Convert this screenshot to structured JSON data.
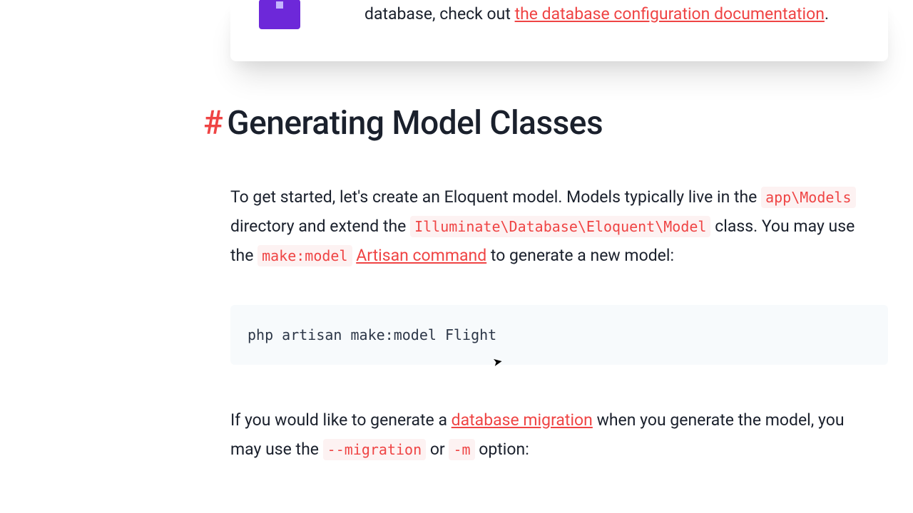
{
  "callout": {
    "text_prefix": "database, check out ",
    "link_text": "the database configuration documentation",
    "text_suffix": "."
  },
  "heading": {
    "hash": "#",
    "title": "Generating Model Classes"
  },
  "para1": {
    "t1": "To get started, let's create an Eloquent model. Models typically live in the ",
    "code1": "app\\Models",
    "t2": " directory and extend the ",
    "code2": "Illuminate\\Database\\Eloquent\\Model",
    "t3": " class. You may use the ",
    "code3": "make:model",
    "t4": " ",
    "link": "Artisan command",
    "t5": " to generate a new model:"
  },
  "codeblock1": "php artisan make:model Flight",
  "para2": {
    "t1": "If you would like to generate a ",
    "link": "database migration",
    "t2": " when you generate the model, you may use the ",
    "code1": "--migration",
    "t3": " or ",
    "code2": "-m",
    "t4": " option:"
  },
  "colors": {
    "accent_red": "#ef4444",
    "accent_purple": "#6d28d9",
    "code_bg": "#f7fafc",
    "inline_code_bg": "#fdf2f2"
  }
}
